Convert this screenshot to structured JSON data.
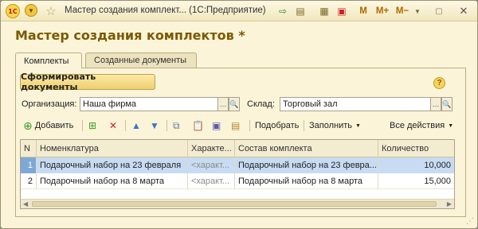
{
  "titlebar": {
    "logo_text": "1С",
    "title": "Мастер создания комплект...  (1С:Предприятие)",
    "mem_m": "M",
    "mem_mplus": "M+",
    "mem_mminus": "M−",
    "icons": [
      "back-icon",
      "star-icon",
      "forward-icon",
      "document-icon",
      "calculator-icon",
      "calendar-icon",
      "pin-icon",
      "close-icon"
    ]
  },
  "form": {
    "title": "Мастер создания комплектов *",
    "tabs": [
      {
        "label": "Комплекты",
        "active": true
      },
      {
        "label": "Созданные документы",
        "active": false
      }
    ],
    "primary_button": "Сформировать документы",
    "help": "?",
    "fields": {
      "org_label": "Организация:",
      "org_value": "Наша фирма",
      "warehouse_label": "Склад:",
      "warehouse_value": "Торговый зал"
    }
  },
  "toolbar": {
    "add": "Добавить",
    "pick": "Подобрать",
    "fill": "Заполнить",
    "all_actions": "Все действия"
  },
  "table": {
    "columns": [
      "N",
      "Номенклатура",
      "Характе...",
      "Состав комплекта",
      "Количество"
    ],
    "rows": [
      {
        "n": "1",
        "item": "Подарочный набор на 23 февраля",
        "characteristic": "<характ...",
        "composition": "Подарочный набор на 23 февра...",
        "quantity": "10,000",
        "selected": true
      },
      {
        "n": "2",
        "item": "Подарочный набор на 8 марта",
        "characteristic": "<характ...",
        "composition": "Подарочный набор на 8 марта",
        "quantity": "15,000",
        "selected": false
      }
    ]
  },
  "colors": {
    "window_bg": "#fbf4d8",
    "title_color": "#7a5a00",
    "selection": "#c7dcf2",
    "delete_red": "#cc2222"
  }
}
